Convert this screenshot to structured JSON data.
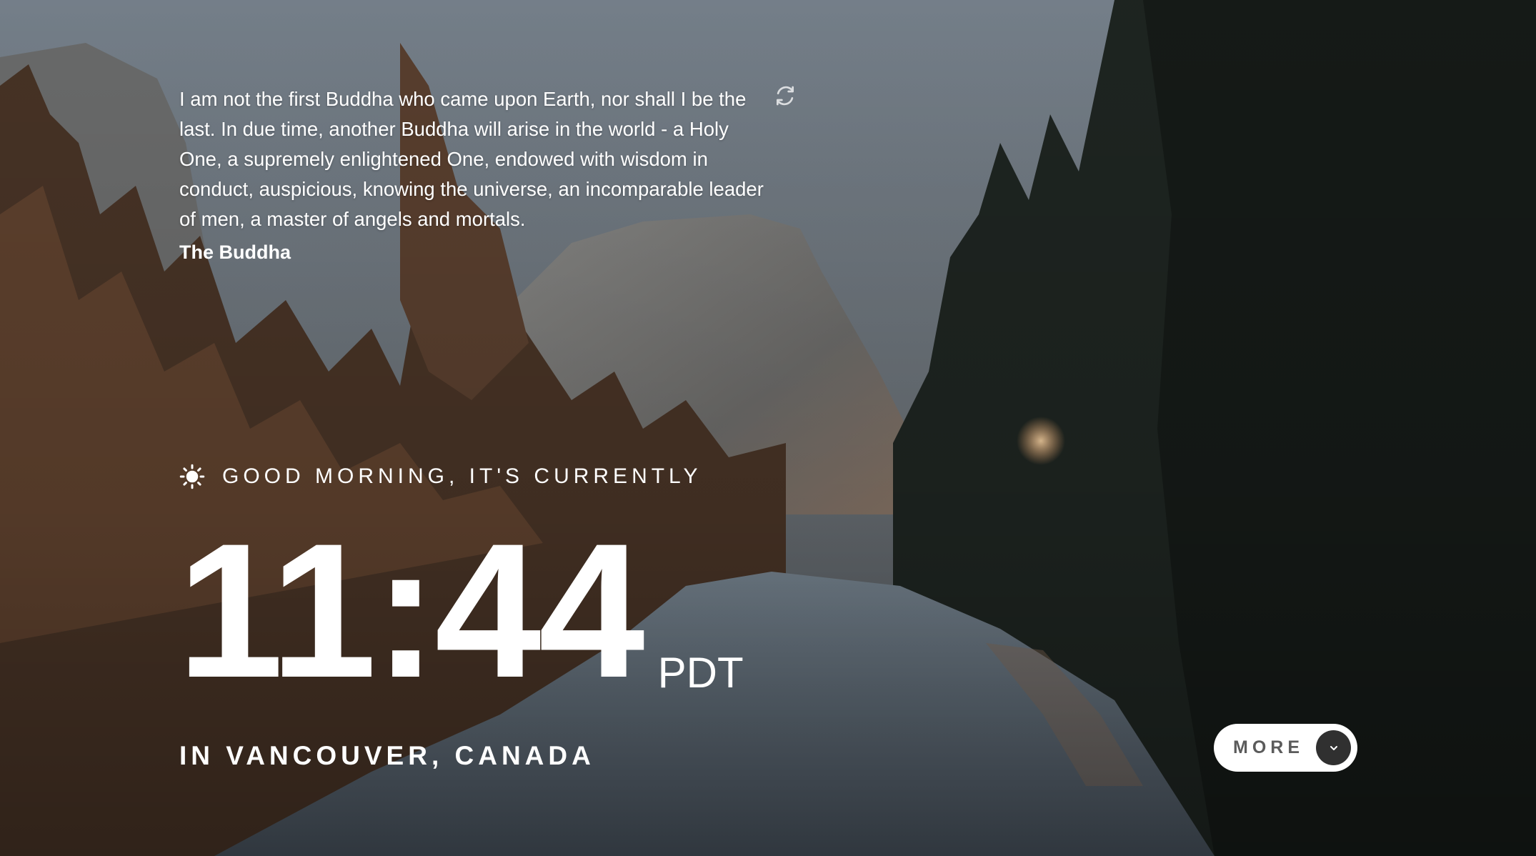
{
  "quote": {
    "text": "I am not the first Buddha who came upon Earth, nor shall I be the last. In due time, another Buddha will arise in the world - a Holy One, a supremely enlightened One, endowed with wisdom in conduct, auspicious, knowing the universe, an incomparable leader of men, a master of angels and mortals.",
    "author": "The Buddha",
    "refresh_icon": "refresh-icon"
  },
  "greeting": {
    "icon": "sun-icon",
    "text": "GOOD MORNING, IT'S CURRENTLY"
  },
  "clock": {
    "time": "11:44",
    "timezone": "PDT"
  },
  "location": {
    "text": "IN VANCOUVER, CANADA"
  },
  "more_button": {
    "label": "MORE",
    "icon": "chevron-down-icon"
  },
  "colors": {
    "text": "#ffffff",
    "button_bg": "#ffffff",
    "button_text": "#5b5b5b",
    "chevron_bg": "#303030"
  }
}
